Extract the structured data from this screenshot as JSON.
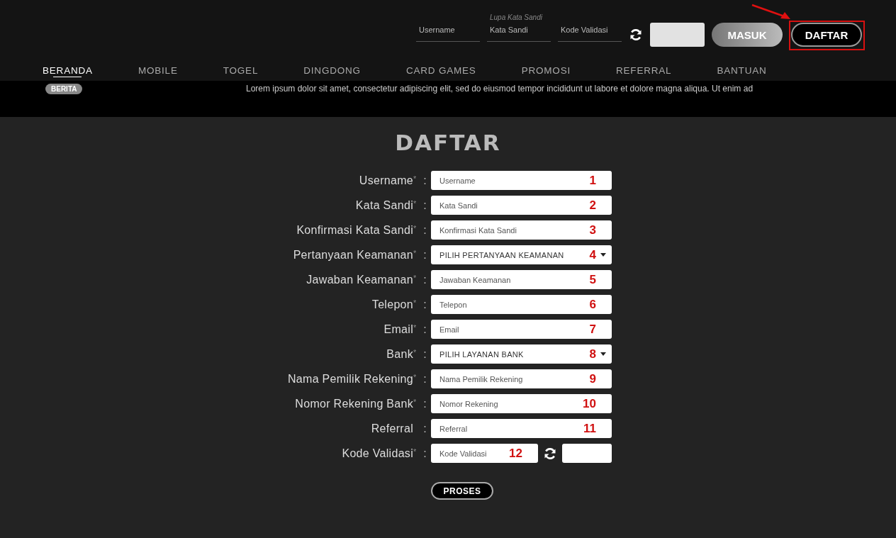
{
  "header": {
    "login_fields": [
      {
        "placeholder": "Username"
      },
      {
        "placeholder": "Kata Sandi",
        "hint": "Lupa Kata Sandi"
      },
      {
        "placeholder": "Kode Validasi"
      }
    ],
    "login_button": "MASUK",
    "register_button": {
      "label": "DAFTAR",
      "highlighted": true
    }
  },
  "nav": [
    {
      "label": "BERANDA",
      "selected": true
    },
    {
      "label": "MOBILE",
      "selected": false
    },
    {
      "label": "TOGEL",
      "selected": false
    },
    {
      "label": "DINGDONG",
      "selected": false
    },
    {
      "label": "CARD GAMES",
      "selected": false
    },
    {
      "label": "PROMOSI",
      "selected": false
    },
    {
      "label": "REFERRAL",
      "selected": false
    },
    {
      "label": "BANTUAN",
      "selected": false
    }
  ],
  "news": {
    "badge": "BERITA",
    "text": "Lorem ipsum dolor sit amet, consectetur adipiscing elit, sed do eiusmod tempor incididunt ut labore et dolore magna aliqua. Ut enim ad"
  },
  "form": {
    "title": "DAFTAR",
    "rows": [
      {
        "label": "Username",
        "required_mark": "*",
        "kind": "text",
        "placeholder": "Username",
        "annotation": "1"
      },
      {
        "label": "Kata Sandi",
        "required_mark": "*",
        "kind": "text",
        "placeholder": "Kata Sandi",
        "annotation": "2"
      },
      {
        "label": "Konfirmasi Kata Sandi",
        "required_mark": "*",
        "kind": "text",
        "placeholder": "Konfirmasi Kata Sandi",
        "annotation": "3"
      },
      {
        "label": "Pertanyaan Keamanan",
        "required_mark": "*",
        "kind": "select",
        "value": "PILIH PERTANYAAN KEAMANAN",
        "annotation": "4"
      },
      {
        "label": "Jawaban Keamanan",
        "required_mark": "*",
        "kind": "text",
        "placeholder": "Jawaban Keamanan",
        "annotation": "5"
      },
      {
        "label": "Telepon",
        "required_mark": "*",
        "kind": "text",
        "placeholder": "Telepon",
        "annotation": "6"
      },
      {
        "label": "Email",
        "required_mark": "*",
        "kind": "text",
        "placeholder": "Email",
        "annotation": "7"
      },
      {
        "label": "Bank",
        "required_mark": "*",
        "kind": "select",
        "value": "PILIH LAYANAN BANK",
        "annotation": "8"
      },
      {
        "label": "Nama Pemilik Rekening",
        "required_mark": "*",
        "kind": "text",
        "placeholder": "Nama Pemilik Rekening",
        "annotation": "9"
      },
      {
        "label": "Nomor Rekening Bank",
        "required_mark": "*",
        "kind": "text",
        "placeholder": "Nomor Rekening",
        "annotation": "10"
      },
      {
        "label": "Referral",
        "kind": "text",
        "placeholder": "Referral",
        "annotation": "11"
      },
      {
        "label": "Kode Validasi",
        "required_mark": "*",
        "kind": "captcha",
        "placeholder": "Kode Validasi",
        "annotation": "12"
      }
    ],
    "colon": ":",
    "submit": "PROSES"
  }
}
